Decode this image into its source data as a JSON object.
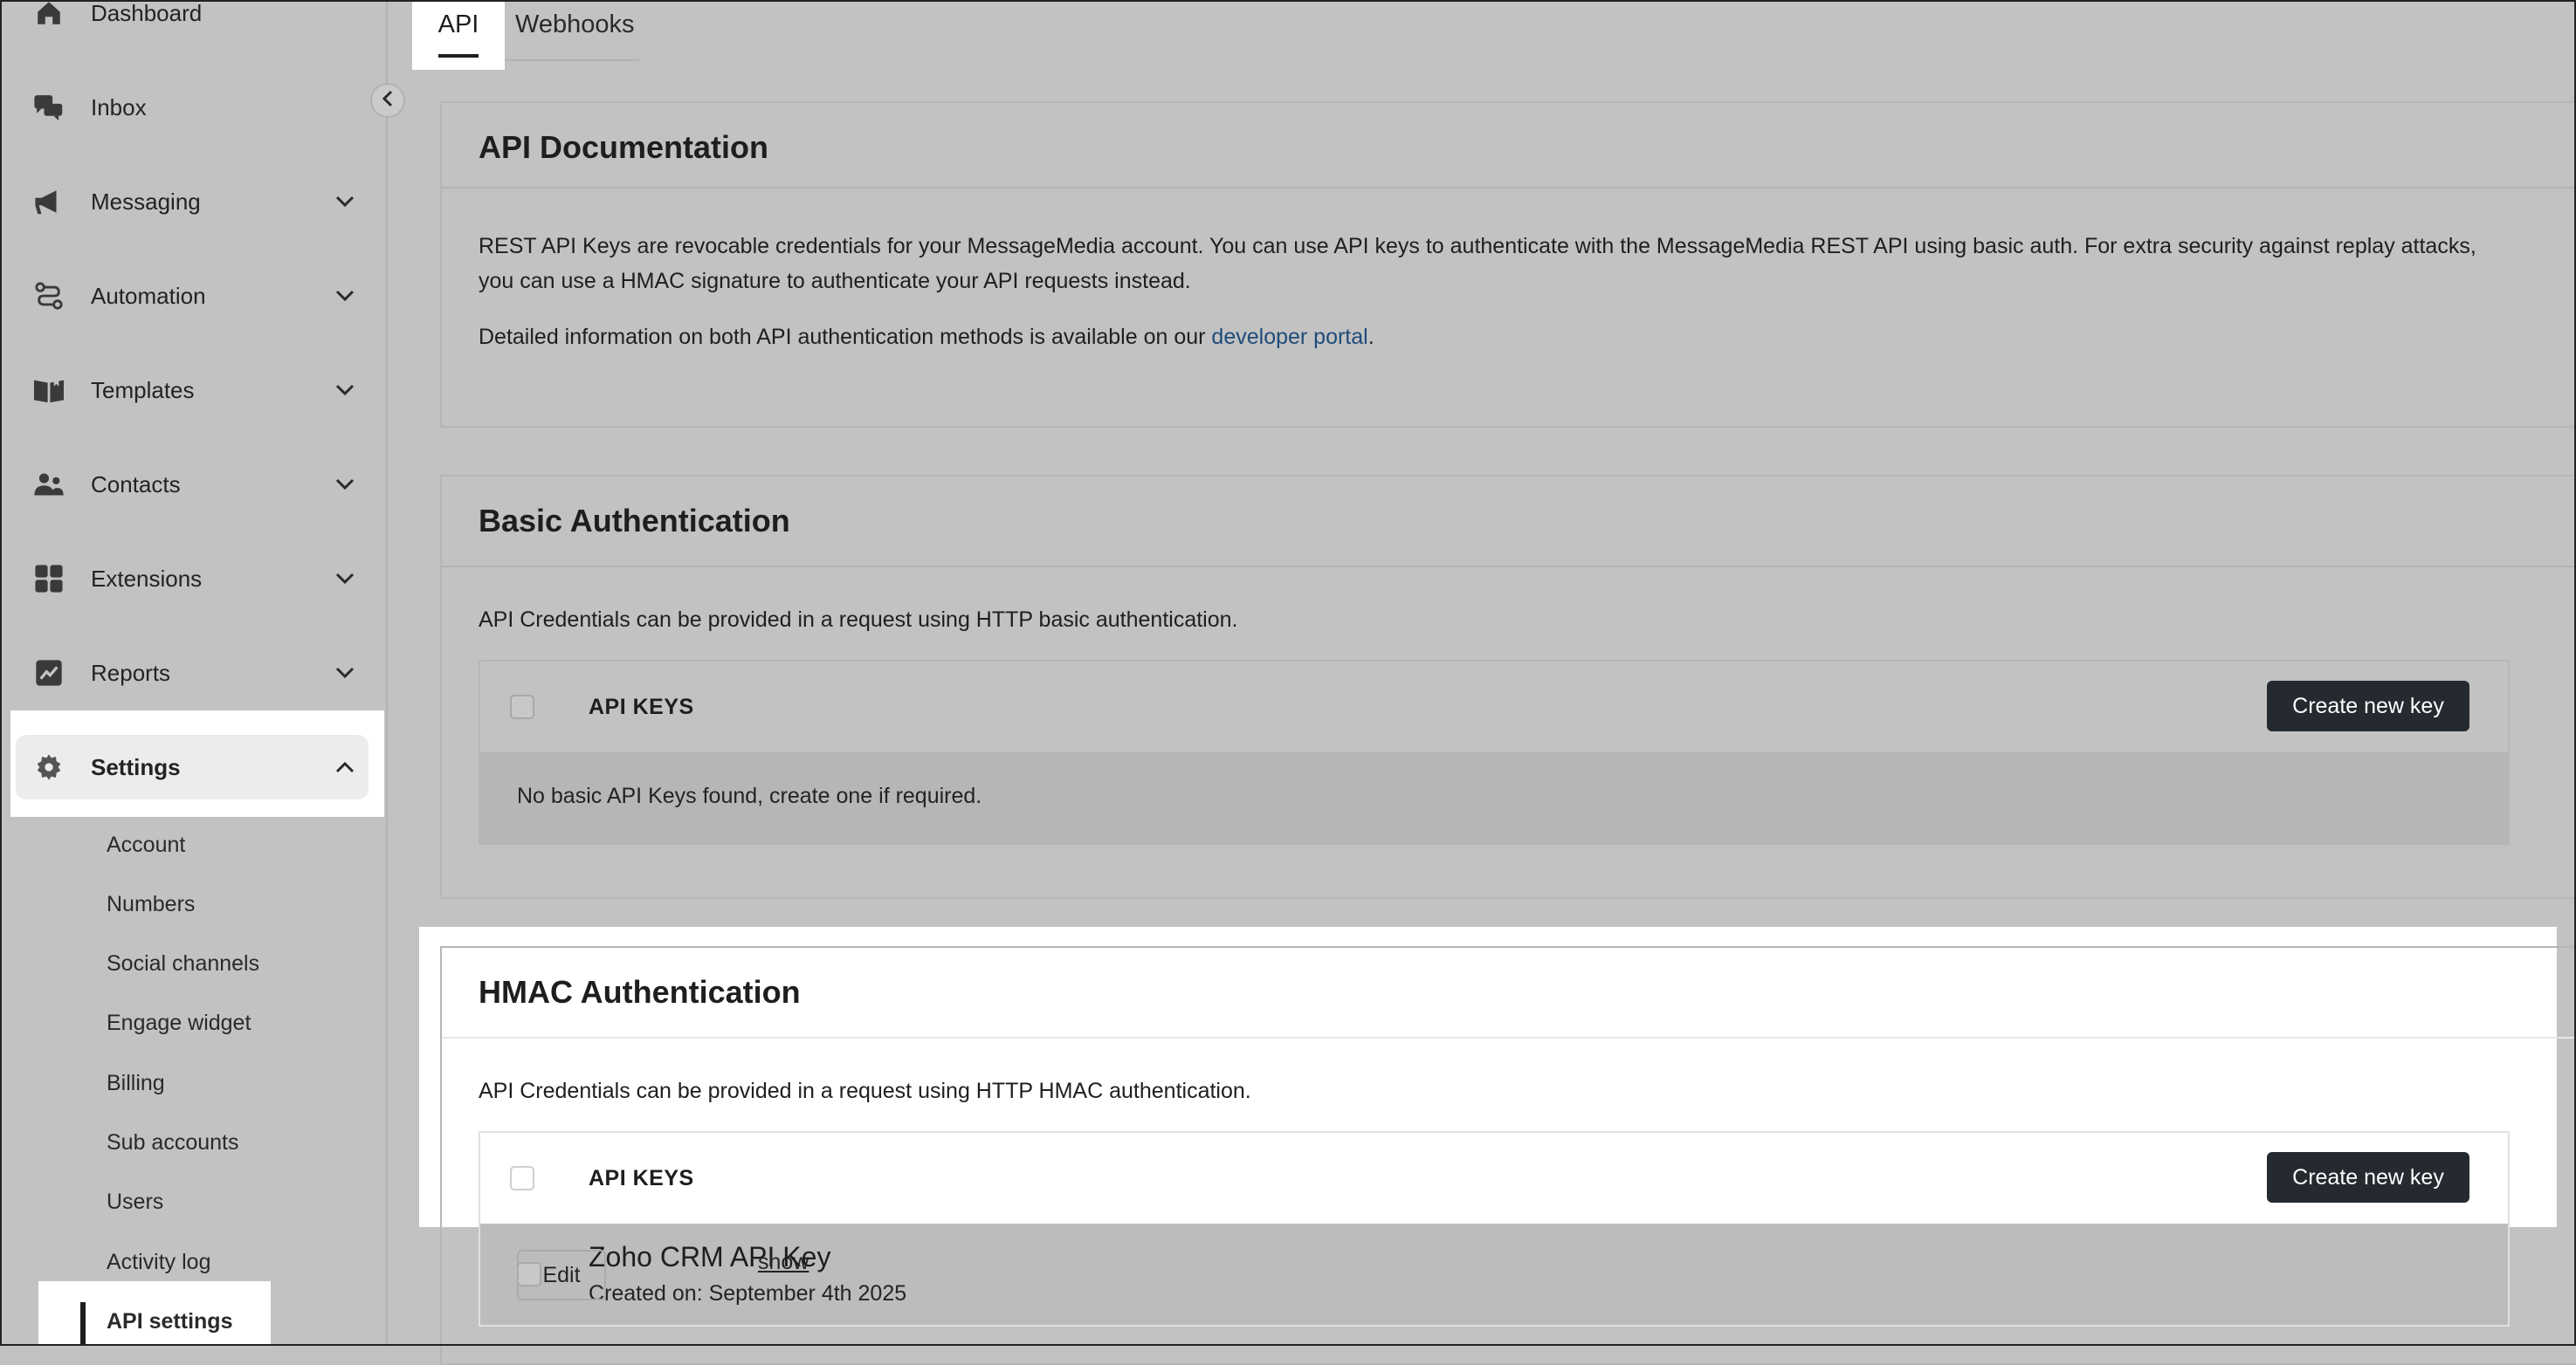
{
  "sidebar": {
    "items": [
      {
        "label": "Dashboard",
        "icon": "home-icon"
      },
      {
        "label": "Inbox",
        "icon": "chat-bubbles-icon"
      },
      {
        "label": "Messaging",
        "icon": "megaphone-icon"
      },
      {
        "label": "Automation",
        "icon": "route-icon"
      },
      {
        "label": "Templates",
        "icon": "book-icon"
      },
      {
        "label": "Contacts",
        "icon": "people-icon"
      },
      {
        "label": "Extensions",
        "icon": "grid-icon"
      },
      {
        "label": "Reports",
        "icon": "chart-icon"
      },
      {
        "label": "Settings",
        "icon": "gear-icon"
      }
    ],
    "settings_sub": [
      "Account",
      "Numbers",
      "Social channels",
      "Engage widget",
      "Billing",
      "Sub accounts",
      "Users",
      "Activity log",
      "API settings"
    ]
  },
  "tabs": [
    {
      "label": "API",
      "active": true
    },
    {
      "label": "Webhooks",
      "active": false
    }
  ],
  "api_docs": {
    "title": "API Documentation",
    "para1_line1": "REST API Keys are revocable credentials for your MessageMedia account. You can use API keys to authenticate with the MessageMedia REST API using basic auth. For extra security against replay attacks,",
    "para1_line2": "you can use a HMAC signature to authenticate your API requests instead.",
    "para2_prefix": "Detailed information on both API authentication methods is available on our ",
    "para2_link": "developer portal",
    "para2_suffix": "."
  },
  "basic_auth": {
    "title": "Basic Authentication",
    "description": "API Credentials can be provided in a request using HTTP basic authentication.",
    "table_header": "API KEYS",
    "create_button": "Create new key",
    "empty_message": "No basic API Keys found, create one if required."
  },
  "hmac_auth": {
    "title": "HMAC Authentication",
    "description": "API Credentials can be provided in a request using HTTP HMAC authentication.",
    "table_header": "API KEYS",
    "create_button": "Create new key",
    "keys": [
      {
        "name": "Zoho CRM API Key",
        "show_label": "show",
        "created": "Created on: September 4th 2025",
        "edit_label": "Edit"
      }
    ]
  },
  "colors": {
    "background": "#c2c2c2",
    "button_dark": "#252a30",
    "link": "#1f4b7a",
    "highlight": "#ffffff"
  }
}
